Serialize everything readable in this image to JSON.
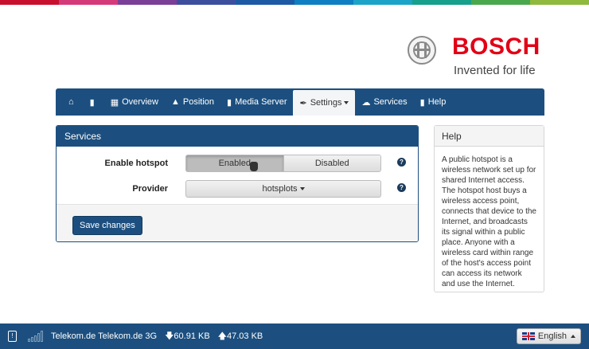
{
  "rainbow": [
    "#c8102e",
    "#d43a7a",
    "#7b3f97",
    "#3d4e9e",
    "#1d5aa5",
    "#0d7fc2",
    "#1ca3c8",
    "#17a08b",
    "#4aa84c",
    "#8fba3d"
  ],
  "brand": {
    "name": "BOSCH",
    "tagline": "Invented for life",
    "color": "#e20015"
  },
  "nav": {
    "items": [
      {
        "label": "",
        "icon": "home-icon"
      },
      {
        "label": "",
        "icon": "chat-icon"
      },
      {
        "label": "Overview",
        "icon": "grid-icon"
      },
      {
        "label": "Position",
        "icon": "road-icon"
      },
      {
        "label": "Media Server",
        "icon": "file-icon"
      },
      {
        "label": "Settings",
        "icon": "wrench-icon",
        "active": true
      },
      {
        "label": "Services",
        "icon": "cloud-icon"
      },
      {
        "label": "Help",
        "icon": "book-icon"
      }
    ]
  },
  "services": {
    "title": "Services",
    "hotspot_label": "Enable hotspot",
    "enabled_label": "Enabled",
    "disabled_label": "Disabled",
    "hotspot_state": "Enabled",
    "provider_label": "Provider",
    "provider_value": "hotsplots",
    "save_label": "Save changes"
  },
  "help": {
    "title": "Help",
    "text": "A public hotspot is a wireless network set up for shared Internet access. The hotspot host buys a wireless access point, connects that device to the Internet, and broadcasts its signal within a public place. Anyone with a wireless card within range of the host's access point can access its network and use the Internet."
  },
  "footer": {
    "sim_label": "!",
    "signal_bars": 0,
    "carrier": "Telekom.de Telekom.de 3G",
    "download": "60.91 KB",
    "upload": "47.03 KB",
    "language": "English"
  }
}
